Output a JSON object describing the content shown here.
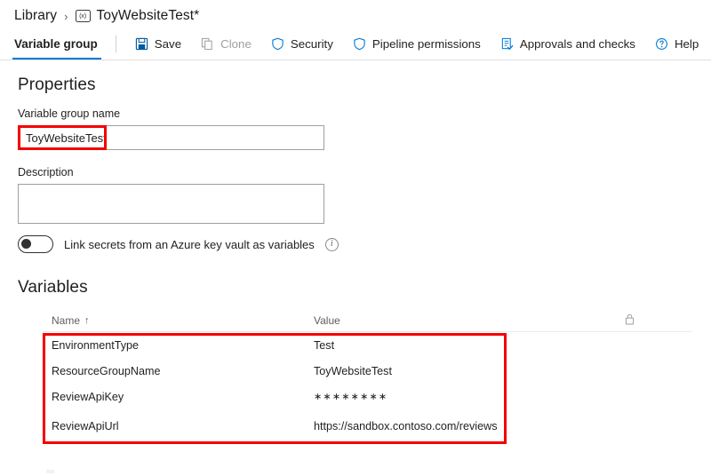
{
  "breadcrumb": {
    "root_label": "Library",
    "separator": "›",
    "group_icon": "variable-group-icon",
    "group_icon_text": "(x)",
    "current_label": "ToyWebsiteTest*"
  },
  "commandbar": {
    "tab_label": "Variable group",
    "commands": [
      {
        "label": "Save",
        "icon": "save-icon",
        "enabled": true
      },
      {
        "label": "Clone",
        "icon": "clone-icon",
        "enabled": false
      },
      {
        "label": "Security",
        "icon": "shield-icon",
        "enabled": true
      },
      {
        "label": "Pipeline permissions",
        "icon": "shield-icon",
        "enabled": true
      },
      {
        "label": "Approvals and checks",
        "icon": "checklist-icon",
        "enabled": true
      },
      {
        "label": "Help",
        "icon": "help-circle-icon",
        "enabled": true
      }
    ]
  },
  "properties": {
    "title": "Properties",
    "name_label": "Variable group name",
    "name_value": "ToyWebsiteTest",
    "name_placeholder": "",
    "description_label": "Description",
    "description_value": "",
    "description_placeholder": "",
    "keyvault_toggle_label": "Link secrets from an Azure key vault as variables",
    "keyvault_toggle_state": "off",
    "info_icon": "info-circle-icon"
  },
  "variables": {
    "title": "Variables",
    "columns": {
      "name": "Name",
      "sort_indicator": "↑",
      "value": "Value",
      "lock": "lock-icon"
    },
    "rows": [
      {
        "name": "EnvironmentType",
        "value": "Test"
      },
      {
        "name": "ResourceGroupName",
        "value": "ToyWebsiteTest"
      },
      {
        "name": "ReviewApiKey",
        "value": "∗∗∗∗∗∗∗∗",
        "secret": true
      },
      {
        "name": "ReviewApiUrl",
        "value": "https://sandbox.contoso.com/reviews"
      }
    ]
  },
  "annotations": {
    "color": "#f40000",
    "boxes": [
      {
        "target": "variable-group-name-value"
      },
      {
        "target": "variables-table-rows"
      }
    ]
  },
  "theme": {
    "accent": "#0078d4",
    "text": "#201f1e",
    "muted": "#605e5c",
    "border": "#e1dfdd",
    "disabled": "#a19f9d"
  }
}
